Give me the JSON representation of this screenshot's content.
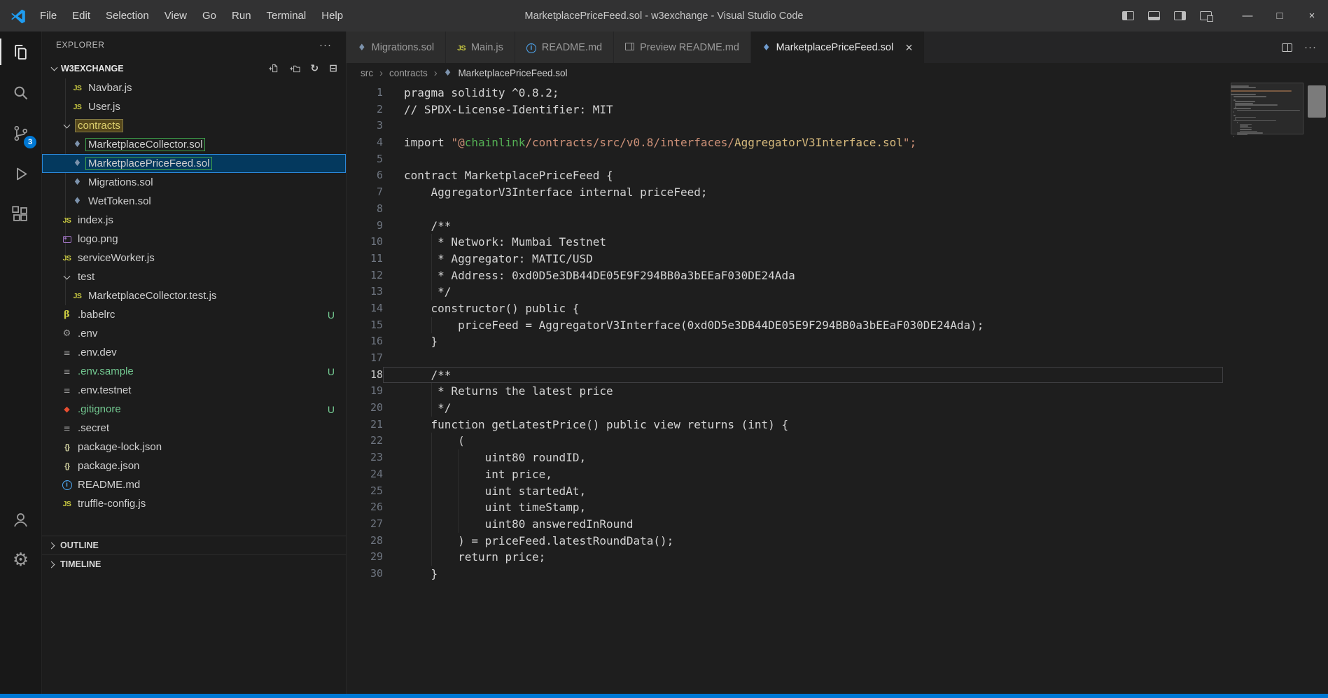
{
  "titlebar": {
    "title": "MarketplacePriceFeed.sol - w3exchange - Visual Studio Code",
    "menus": [
      "File",
      "Edit",
      "Selection",
      "View",
      "Go",
      "Run",
      "Terminal",
      "Help"
    ],
    "layout_toggles": [
      "toggle-primary-sidebar",
      "toggle-panel",
      "toggle-secondary-sidebar",
      "customize-layout"
    ],
    "window_controls": [
      "minimize",
      "maximize",
      "close"
    ]
  },
  "activity_bar": {
    "items": [
      {
        "name": "explorer",
        "active": true
      },
      {
        "name": "search"
      },
      {
        "name": "source-control",
        "badge": "3"
      },
      {
        "name": "run-debug"
      },
      {
        "name": "extensions"
      }
    ],
    "bottom": [
      {
        "name": "account"
      },
      {
        "name": "settings"
      }
    ]
  },
  "explorer": {
    "title": "EXPLORER",
    "section": "W3EXCHANGE",
    "actions": [
      "new-file",
      "new-folder",
      "refresh",
      "collapse-all"
    ],
    "tree": [
      {
        "label": "Navbar.js",
        "icon": "js",
        "level": 2
      },
      {
        "label": "User.js",
        "icon": "js",
        "level": 2
      },
      {
        "label": "contracts",
        "level": 1,
        "folder": true,
        "match": "yellow"
      },
      {
        "label": "MarketplaceCollector.sol",
        "icon": "sol",
        "level": 2,
        "match": "green"
      },
      {
        "label": "MarketplacePriceFeed.sol",
        "icon": "sol",
        "level": 2,
        "selected": true,
        "match": "green"
      },
      {
        "label": "Migrations.sol",
        "icon": "sol",
        "level": 2
      },
      {
        "label": "WetToken.sol",
        "icon": "sol",
        "level": 2
      },
      {
        "label": "index.js",
        "icon": "js",
        "level": 1
      },
      {
        "label": "logo.png",
        "icon": "image",
        "level": 1
      },
      {
        "label": "serviceWorker.js",
        "icon": "js",
        "level": 1
      },
      {
        "label": "test",
        "level": 1,
        "folder": true
      },
      {
        "label": "MarketplaceCollector.test.js",
        "icon": "js",
        "level": 2
      },
      {
        "label": ".babelrc",
        "icon": "babel",
        "level": 1,
        "badge": "U"
      },
      {
        "label": ".env",
        "icon": "gear",
        "level": 1
      },
      {
        "label": ".env.dev",
        "icon": "list",
        "level": 1
      },
      {
        "label": ".env.sample",
        "icon": "list",
        "level": 1,
        "badge": "U",
        "git": "untracked"
      },
      {
        "label": ".env.testnet",
        "icon": "list",
        "level": 1
      },
      {
        "label": ".gitignore",
        "icon": "git",
        "level": 1,
        "badge": "U",
        "git": "untracked"
      },
      {
        "label": ".secret",
        "icon": "list",
        "level": 1
      },
      {
        "label": "package-lock.json",
        "icon": "json",
        "level": 1
      },
      {
        "label": "package.json",
        "icon": "json",
        "level": 1
      },
      {
        "label": "README.md",
        "icon": "info",
        "level": 1
      },
      {
        "label": "truffle-config.js",
        "icon": "js",
        "level": 1
      }
    ],
    "sections_bottom": [
      "OUTLINE",
      "TIMELINE"
    ]
  },
  "tabs": [
    {
      "label": "Migrations.sol",
      "icon": "sol"
    },
    {
      "label": "Main.js",
      "icon": "js"
    },
    {
      "label": "README.md",
      "icon": "info"
    },
    {
      "label": "Preview README.md",
      "icon": "preview"
    },
    {
      "label": "MarketplacePriceFeed.sol",
      "icon": "sol",
      "active": true
    }
  ],
  "breadcrumbs": [
    "src",
    "contracts",
    "MarketplacePriceFeed.sol"
  ],
  "editor": {
    "current_line": 18,
    "lines": [
      {
        "n": 1,
        "t": [
          [
            "fg",
            "pragma solidity ^0.8.2;"
          ]
        ]
      },
      {
        "n": 2,
        "t": [
          [
            "fg",
            "// SPDX-License-Identifier: MIT"
          ]
        ]
      },
      {
        "n": 3,
        "t": []
      },
      {
        "n": 4,
        "t": [
          [
            "fg",
            "import "
          ],
          [
            "str",
            "\"@"
          ],
          [
            "grn",
            "chainlink"
          ],
          [
            "str",
            "/contracts/src/v0.8/interfaces/"
          ],
          [
            "yel",
            "AggregatorV3Interface.sol"
          ],
          [
            "str",
            "\";"
          ]
        ]
      },
      {
        "n": 5,
        "t": []
      },
      {
        "n": 6,
        "t": [
          [
            "fg",
            "contract MarketplacePriceFeed {"
          ]
        ]
      },
      {
        "n": 7,
        "t": [
          [
            "fg",
            "    AggregatorV3Interface internal priceFeed;"
          ]
        ]
      },
      {
        "n": 8,
        "t": []
      },
      {
        "n": 9,
        "t": [
          [
            "fg",
            "    /**"
          ]
        ]
      },
      {
        "n": 10,
        "t": [
          [
            "fg",
            "     * Network: Mumbai Testnet"
          ]
        ]
      },
      {
        "n": 11,
        "t": [
          [
            "fg",
            "     * Aggregator: MATIC/USD"
          ]
        ]
      },
      {
        "n": 12,
        "t": [
          [
            "fg",
            "     * Address: 0xd0D5e3DB44DE05E9F294BB0a3bEEaF030DE24Ada"
          ]
        ]
      },
      {
        "n": 13,
        "t": [
          [
            "fg",
            "     */"
          ]
        ]
      },
      {
        "n": 14,
        "t": [
          [
            "fg",
            "    constructor() public {"
          ]
        ]
      },
      {
        "n": 15,
        "t": [
          [
            "fg",
            "        priceFeed = AggregatorV3Interface(0xd0D5e3DB44DE05E9F294BB0a3bEEaF030DE24Ada);"
          ]
        ]
      },
      {
        "n": 16,
        "t": [
          [
            "fg",
            "    }"
          ]
        ]
      },
      {
        "n": 17,
        "t": []
      },
      {
        "n": 18,
        "t": [
          [
            "fg",
            "    /**"
          ]
        ]
      },
      {
        "n": 19,
        "t": [
          [
            "fg",
            "     * Returns the latest price"
          ]
        ]
      },
      {
        "n": 20,
        "t": [
          [
            "fg",
            "     */"
          ]
        ]
      },
      {
        "n": 21,
        "t": [
          [
            "fg",
            "    function getLatestPrice() public view returns (int) {"
          ]
        ]
      },
      {
        "n": 22,
        "t": [
          [
            "fg",
            "        ("
          ]
        ]
      },
      {
        "n": 23,
        "t": [
          [
            "fg",
            "            uint80 roundID,"
          ]
        ]
      },
      {
        "n": 24,
        "t": [
          [
            "fg",
            "            int price,"
          ]
        ]
      },
      {
        "n": 25,
        "t": [
          [
            "fg",
            "            uint startedAt,"
          ]
        ]
      },
      {
        "n": 26,
        "t": [
          [
            "fg",
            "            uint timeStamp,"
          ]
        ]
      },
      {
        "n": 27,
        "t": [
          [
            "fg",
            "            uint80 answeredInRound"
          ]
        ]
      },
      {
        "n": 28,
        "t": [
          [
            "fg",
            "        ) = priceFeed.latestRoundData();"
          ]
        ]
      },
      {
        "n": 29,
        "t": [
          [
            "fg",
            "        return price;"
          ]
        ]
      },
      {
        "n": 30,
        "t": [
          [
            "fg",
            "    }"
          ]
        ]
      }
    ]
  },
  "colors": {
    "accent_blue": "#0078d4",
    "statusbar_blue": "#0078d4",
    "selection_bg": "#04395e",
    "selection_border": "#2b88d8",
    "untracked_green": "#73c991",
    "match_green": "#3fa34d",
    "string_orange": "#ce9178",
    "identifier_yellow": "#d7ba7d",
    "import_green": "#54b054"
  }
}
